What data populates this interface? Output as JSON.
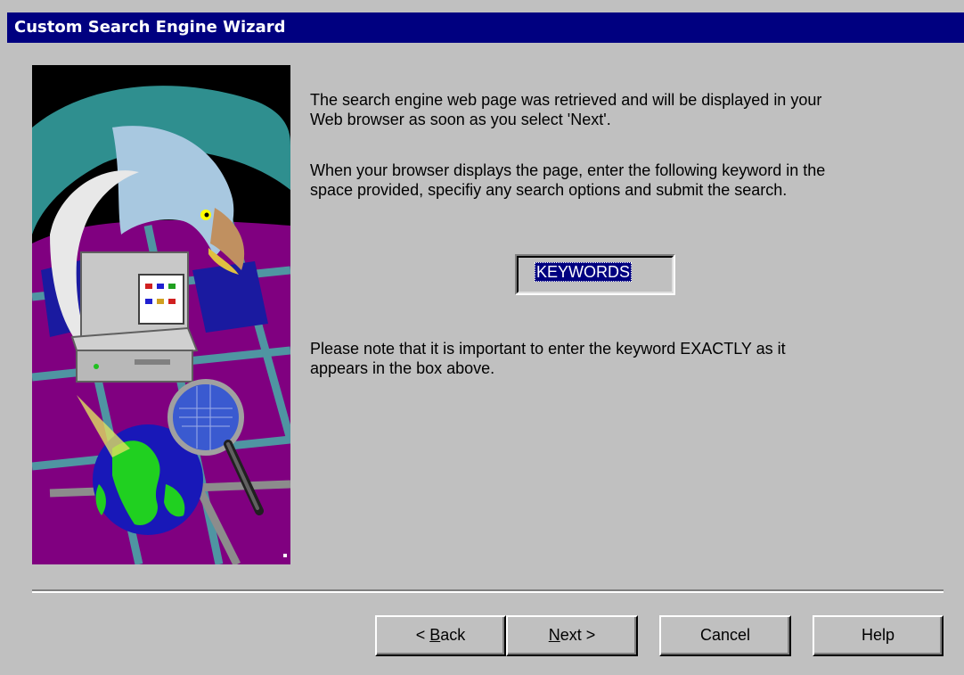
{
  "window": {
    "title": "Custom Search Engine Wizard"
  },
  "content": {
    "paragraph1_line1": "The search engine web page was retrieved and will be displayed in your",
    "paragraph1_line2": "Web browser as soon as you select 'Next'.",
    "paragraph2_line1": "When your browser displays the page, enter the following keyword in the",
    "paragraph2_line2": "space provided, specifiy any search options and submit the search.",
    "keyword": "KEYWORDS",
    "paragraph3_line1": "Please note that it is important to enter the keyword EXACTLY as it",
    "paragraph3_line2": "appears in the box above."
  },
  "buttons": {
    "back_prefix": "< ",
    "back_accel": "B",
    "back_rest": "ack",
    "next_accel": "N",
    "next_rest": "ext >",
    "cancel": "Cancel",
    "help": "Help"
  },
  "colors": {
    "titlebar": "#000080",
    "face": "#c0c0c0",
    "selection": "#000080"
  },
  "icons": {
    "wizard_art": "computer-globe-magnifier-eagle-illustration"
  }
}
